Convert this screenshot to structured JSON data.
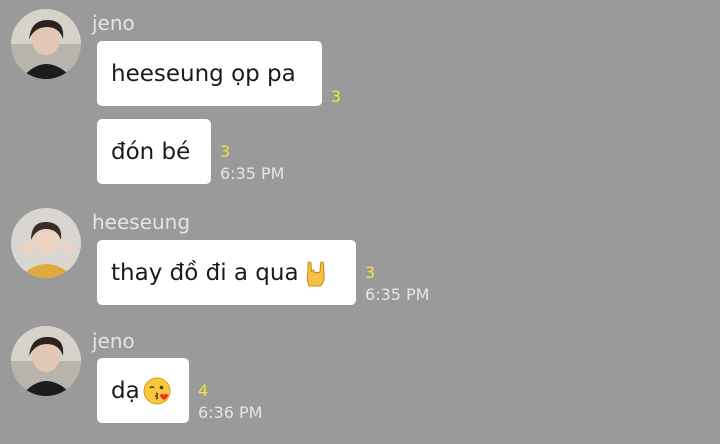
{
  "messages": [
    {
      "sender": "jeno",
      "text": "heeseung ọp pa",
      "unread": "3",
      "time": ""
    },
    {
      "sender": "",
      "text": "đón bé",
      "unread": "3",
      "time": "6:35 PM"
    },
    {
      "sender": "heeseung",
      "text": "thay đồ đi a qua",
      "emoji": "rock-on-hand-emoji",
      "unread": "3",
      "time": "6:35 PM"
    },
    {
      "sender": "jeno",
      "text": "dạ",
      "emoji": "kissing-face-emoji",
      "unread": "4",
      "time": "6:36 PM"
    }
  ],
  "colors": {
    "background": "#9a9a9a",
    "bubble": "#ffffff",
    "unread": "#f4e33b",
    "meta": "#e6e6e6"
  }
}
